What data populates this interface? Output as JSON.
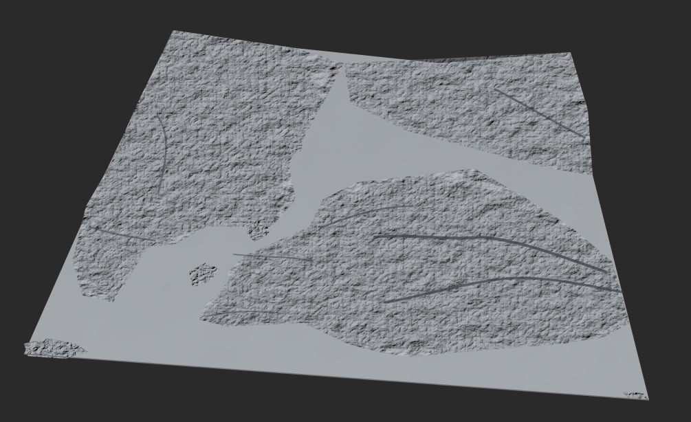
{
  "scene": {
    "type": "3d-terrain-heightmap-viewport",
    "background_color": "#2a2a2a",
    "terrain_base_color": "#a4a9ae",
    "terrain_shadow_color": "#3a3e44",
    "terrain_highlight_color": "#c7cbcf",
    "ui_text": []
  }
}
